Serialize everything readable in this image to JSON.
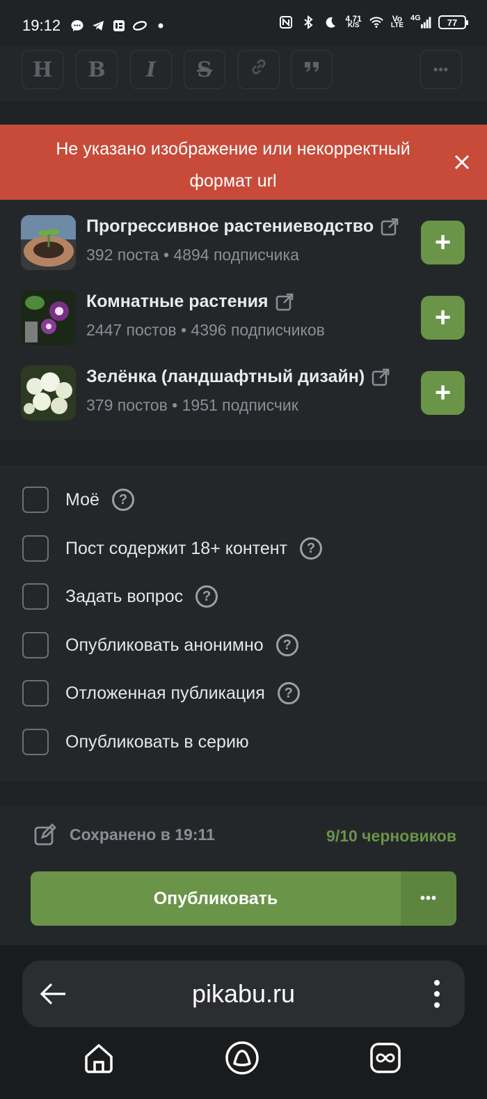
{
  "status_bar": {
    "time": "19:12",
    "net_speed_value": "4,71",
    "net_speed_unit": "K/S",
    "volte_top": "Vo",
    "volte_bottom": "LTE",
    "network": "4G",
    "battery": "77"
  },
  "toolbar": {
    "buttons": [
      {
        "label": "H",
        "icon": "heading-icon"
      },
      {
        "label": "B",
        "icon": "bold-icon"
      },
      {
        "label": "I",
        "icon": "italic-icon"
      },
      {
        "label": "S",
        "icon": "strikethrough-icon"
      },
      {
        "label": "",
        "icon": "link-icon"
      },
      {
        "label": "❞",
        "icon": "quote-icon"
      },
      {
        "label": "•••",
        "icon": "more-icon"
      }
    ]
  },
  "alert": {
    "message": "Не указано изображение или некорректный формат url",
    "color": "#c84b3a"
  },
  "communities": [
    {
      "title": "Прогрессивное растениеводство",
      "stats": "392 поста • 4894 подписчика"
    },
    {
      "title": "Комнатные растения",
      "stats": "2447 постов • 4396 подписчиков"
    },
    {
      "title": "Зелёнка (ландшафтный дизайн)",
      "stats": "379 постов • 1951 подписчик"
    }
  ],
  "options": [
    {
      "label": "Моё",
      "help": true
    },
    {
      "label": "Пост содержит 18+ контент",
      "help": true
    },
    {
      "label": "Задать вопрос",
      "help": true
    },
    {
      "label": "Опубликовать анонимно",
      "help": true
    },
    {
      "label": "Отложенная публикация",
      "help": true
    },
    {
      "label": "Опубликовать в серию",
      "help": false
    }
  ],
  "footer": {
    "saved_text": "Сохранено в 19:11",
    "drafts_text": "9/10 черновиков",
    "publish_label": "Опубликовать",
    "publish_more": "•••"
  },
  "browser": {
    "url": "pikabu.ru"
  },
  "colors": {
    "accent_green": "#6a9447",
    "background": "#24272a"
  }
}
